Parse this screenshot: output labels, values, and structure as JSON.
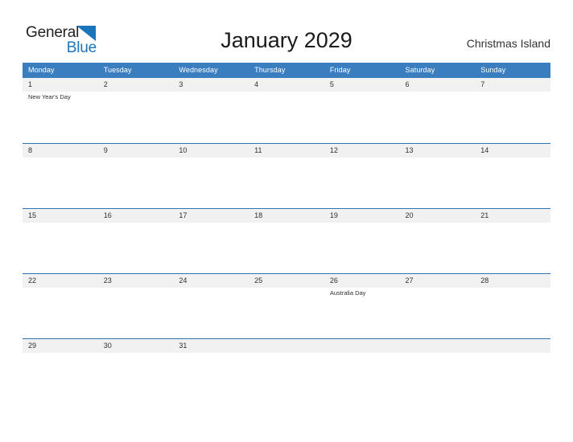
{
  "brand": {
    "name_part1": "General",
    "name_part2": "Blue",
    "triangle_icon": "triangle-icon",
    "color_primary": "#1b75bb",
    "color_text": "#231f20"
  },
  "header": {
    "title": "January 2029",
    "region": "Christmas Island"
  },
  "calendar": {
    "header_bg": "#3a7ebf",
    "header_text_color": "#ffffff",
    "row_divider_color": "#2e75b6",
    "date_band_bg": "#f1f1f1",
    "weekdays": [
      "Monday",
      "Tuesday",
      "Wednesday",
      "Thursday",
      "Friday",
      "Saturday",
      "Sunday"
    ],
    "weeks": [
      {
        "days": [
          {
            "date": "1",
            "event": "New Year's Day"
          },
          {
            "date": "2",
            "event": ""
          },
          {
            "date": "3",
            "event": ""
          },
          {
            "date": "4",
            "event": ""
          },
          {
            "date": "5",
            "event": ""
          },
          {
            "date": "6",
            "event": ""
          },
          {
            "date": "7",
            "event": ""
          }
        ]
      },
      {
        "days": [
          {
            "date": "8",
            "event": ""
          },
          {
            "date": "9",
            "event": ""
          },
          {
            "date": "10",
            "event": ""
          },
          {
            "date": "11",
            "event": ""
          },
          {
            "date": "12",
            "event": ""
          },
          {
            "date": "13",
            "event": ""
          },
          {
            "date": "14",
            "event": ""
          }
        ]
      },
      {
        "days": [
          {
            "date": "15",
            "event": ""
          },
          {
            "date": "16",
            "event": ""
          },
          {
            "date": "17",
            "event": ""
          },
          {
            "date": "18",
            "event": ""
          },
          {
            "date": "19",
            "event": ""
          },
          {
            "date": "20",
            "event": ""
          },
          {
            "date": "21",
            "event": ""
          }
        ]
      },
      {
        "days": [
          {
            "date": "22",
            "event": ""
          },
          {
            "date": "23",
            "event": ""
          },
          {
            "date": "24",
            "event": ""
          },
          {
            "date": "25",
            "event": ""
          },
          {
            "date": "26",
            "event": "Australia Day"
          },
          {
            "date": "27",
            "event": ""
          },
          {
            "date": "28",
            "event": ""
          }
        ]
      },
      {
        "days": [
          {
            "date": "29",
            "event": ""
          },
          {
            "date": "30",
            "event": ""
          },
          {
            "date": "31",
            "event": ""
          },
          {
            "date": "",
            "event": ""
          },
          {
            "date": "",
            "event": ""
          },
          {
            "date": "",
            "event": ""
          },
          {
            "date": "",
            "event": ""
          }
        ]
      }
    ]
  }
}
